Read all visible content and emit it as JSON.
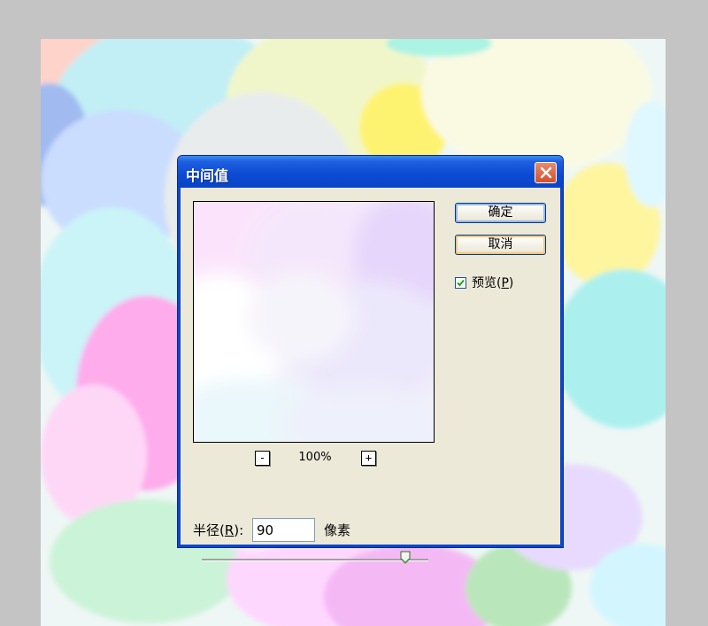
{
  "dialog": {
    "title": "中间值",
    "ok_label": "确定",
    "cancel_label": "取消",
    "preview_checked": true,
    "preview_label_prefix": "预览(",
    "preview_label_key": "P",
    "preview_label_suffix": ")",
    "zoom_out_label": "-",
    "zoom_in_label": "+",
    "zoom_level": "100%",
    "radius_label_prefix": "半径(",
    "radius_label_key": "R",
    "radius_label_suffix": "):",
    "radius_value": "90",
    "radius_unit": "像素",
    "radius_slider_fraction": 0.9
  },
  "icons": {
    "close": "close-icon",
    "check": "checkmark-icon",
    "slider_thumb": "slider-thumb-icon"
  },
  "colors": {
    "titlebar": "#0a4ad4",
    "close_button": "#d2502d",
    "dialog_face": "#ece9d8",
    "desktop": "#c4c4c4"
  }
}
